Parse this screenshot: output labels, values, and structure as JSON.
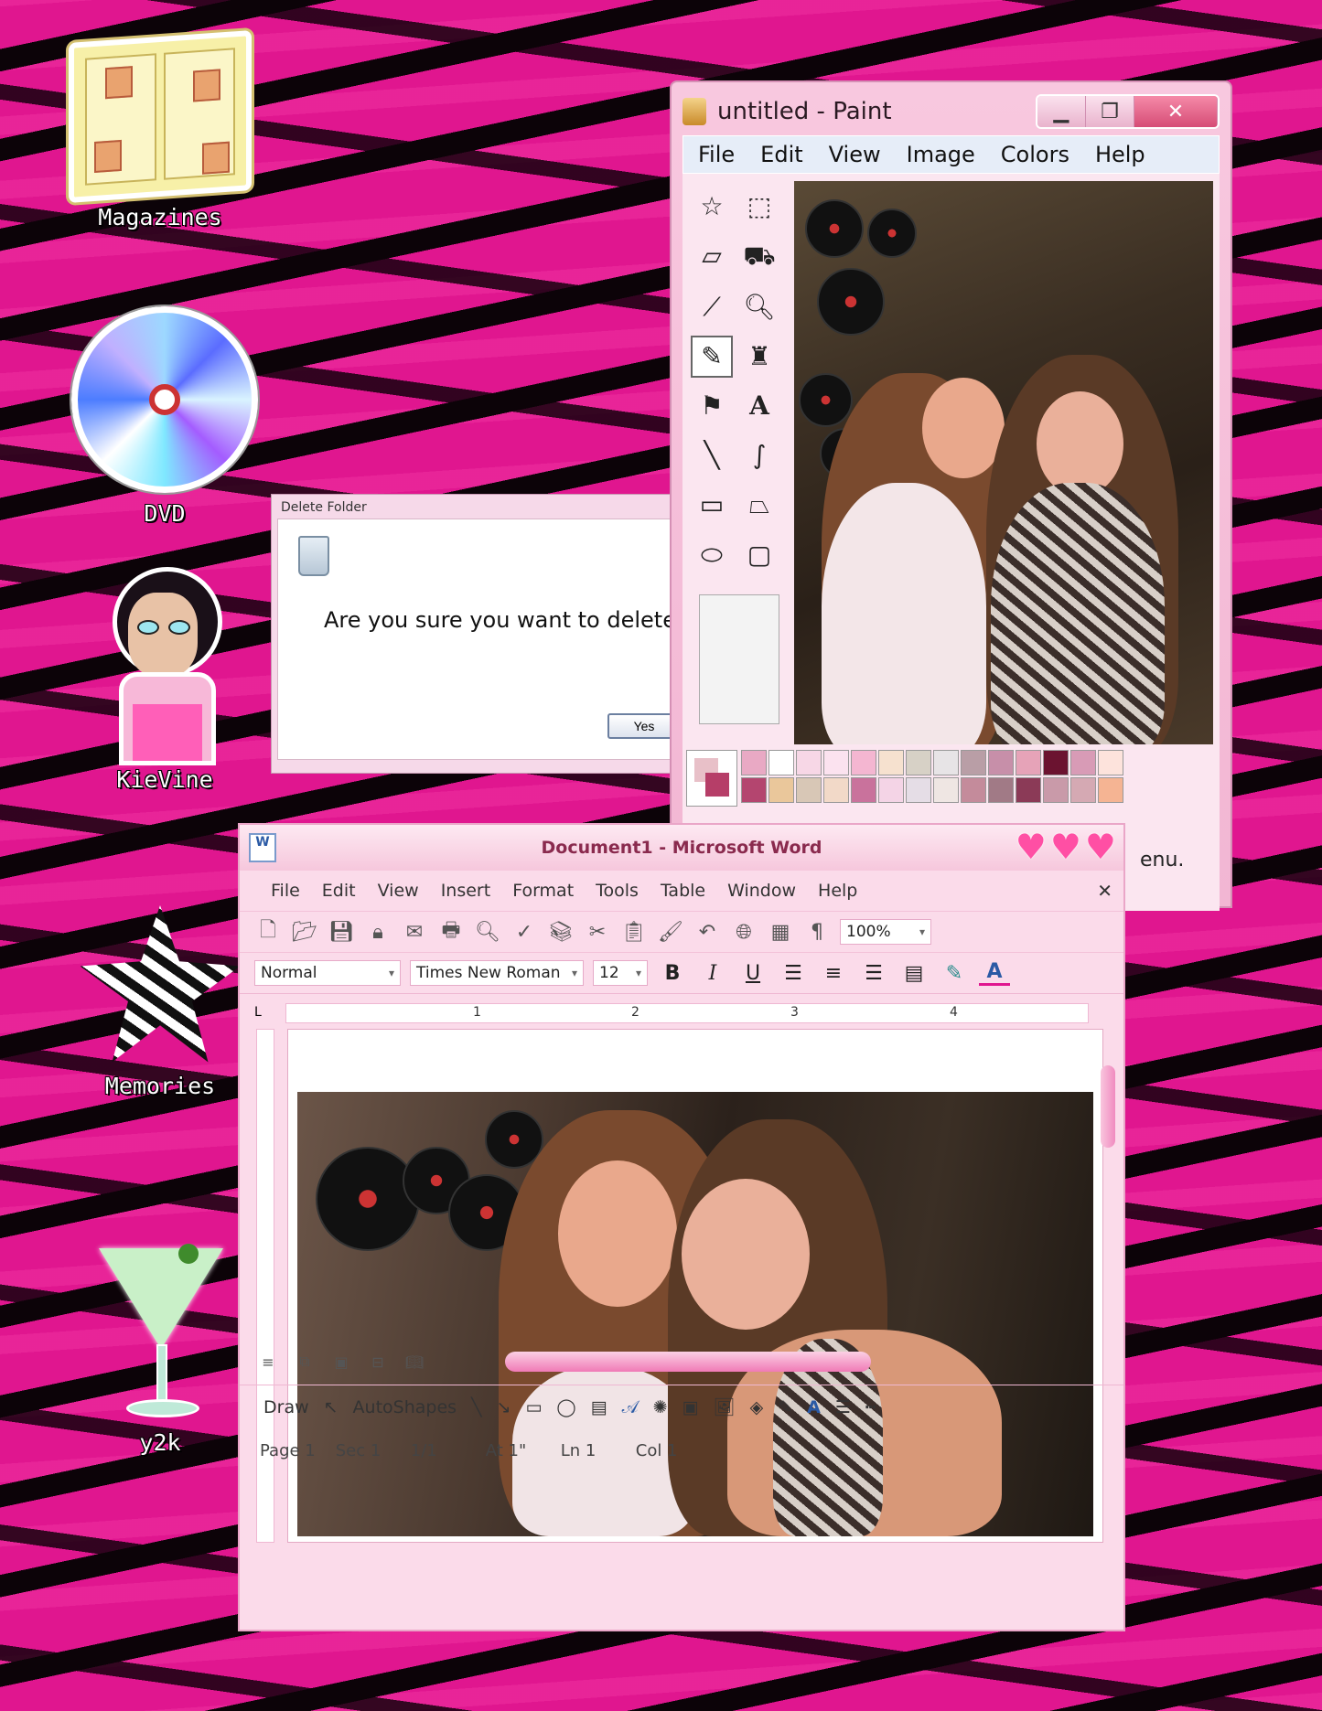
{
  "desktop": {
    "icons": [
      {
        "label": "Magazines",
        "icon": "magazine-icon"
      },
      {
        "label": "DVD",
        "icon": "dvd-icon"
      },
      {
        "label": "KieVine",
        "icon": "doll-icon"
      },
      {
        "label": "Memories",
        "icon": "zebra-star-icon"
      },
      {
        "label": "y2k",
        "icon": "martini-icon"
      }
    ]
  },
  "delete_dialog": {
    "title": "Delete Folder",
    "message": "Are you sure you want to delete",
    "yes_label": "Yes"
  },
  "paint": {
    "title": "untitled - Paint",
    "menu": [
      "File",
      "Edit",
      "View",
      "Image",
      "Colors",
      "Help"
    ],
    "status_fragment": "enu.",
    "palette": [
      "#e9a9c4",
      "#ffffff",
      "#f7d7e6",
      "#fbe2ef",
      "#f4b6d1",
      "#f6e1cf",
      "#d7d1c6",
      "#e7e4e6",
      "#b99ea6",
      "#c78fa9",
      "#e6a3b8",
      "#6b1330",
      "#d89bb6",
      "#fde3dc",
      "#b4456f",
      "#eac79b",
      "#d8c7b6",
      "#f2d9c8",
      "#c9729c",
      "#f4d4e6",
      "#e5dde6",
      "#efe6e3",
      "#c48b9b",
      "#a17a86",
      "#8b3a57",
      "#c99aa9",
      "#d5a9b3",
      "#f5b493"
    ]
  },
  "word": {
    "title": "Document1 - Microsoft Word",
    "menu": [
      "File",
      "Edit",
      "View",
      "Insert",
      "Format",
      "Tools",
      "Table",
      "Window",
      "Help"
    ],
    "zoom": "100%",
    "style": "Normal",
    "font": "Times New Roman",
    "size": "12",
    "ruler_numbers": [
      "1",
      "2",
      "3",
      "4"
    ],
    "draw_label": "Draw",
    "autoshapes_label": "AutoShapes",
    "status": {
      "page": "Page 1",
      "sec": "Sec 1",
      "pages": "1/1",
      "at": "At 1\"",
      "ln": "Ln 1",
      "col": "Col 1"
    }
  }
}
